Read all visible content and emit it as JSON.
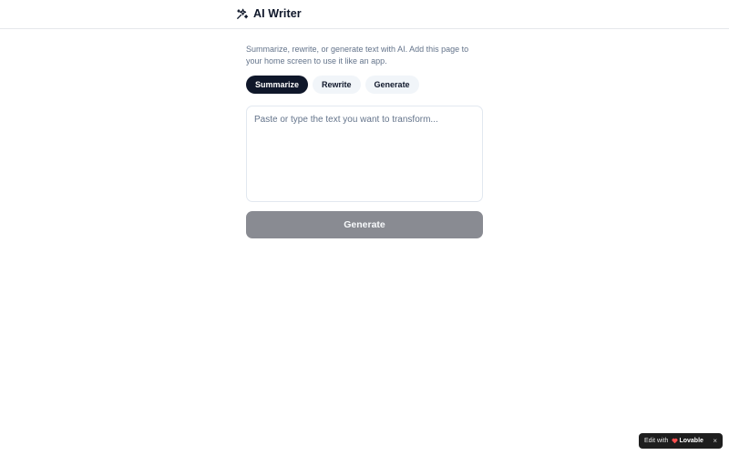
{
  "app": {
    "title": "AI Writer",
    "icon": "sparkles-icon"
  },
  "description": "Summarize, rewrite, or generate text with AI. Add this page to your home screen to use it like an app.",
  "tabs": [
    {
      "label": "Summarize",
      "active": true
    },
    {
      "label": "Rewrite",
      "active": false
    },
    {
      "label": "Generate",
      "active": false
    }
  ],
  "editor": {
    "placeholder": "Paste or type the text you want to transform...",
    "value": ""
  },
  "primary_button": {
    "label": "Generate",
    "disabled": true
  },
  "badge": {
    "edit_label": "Edit with",
    "brand": "Lovable",
    "close": "×"
  },
  "colors": {
    "primary": "#0f172a",
    "muted_text": "#64748b",
    "disabled_button": "#898b92",
    "lovable_heart": "#ff4f4f"
  }
}
